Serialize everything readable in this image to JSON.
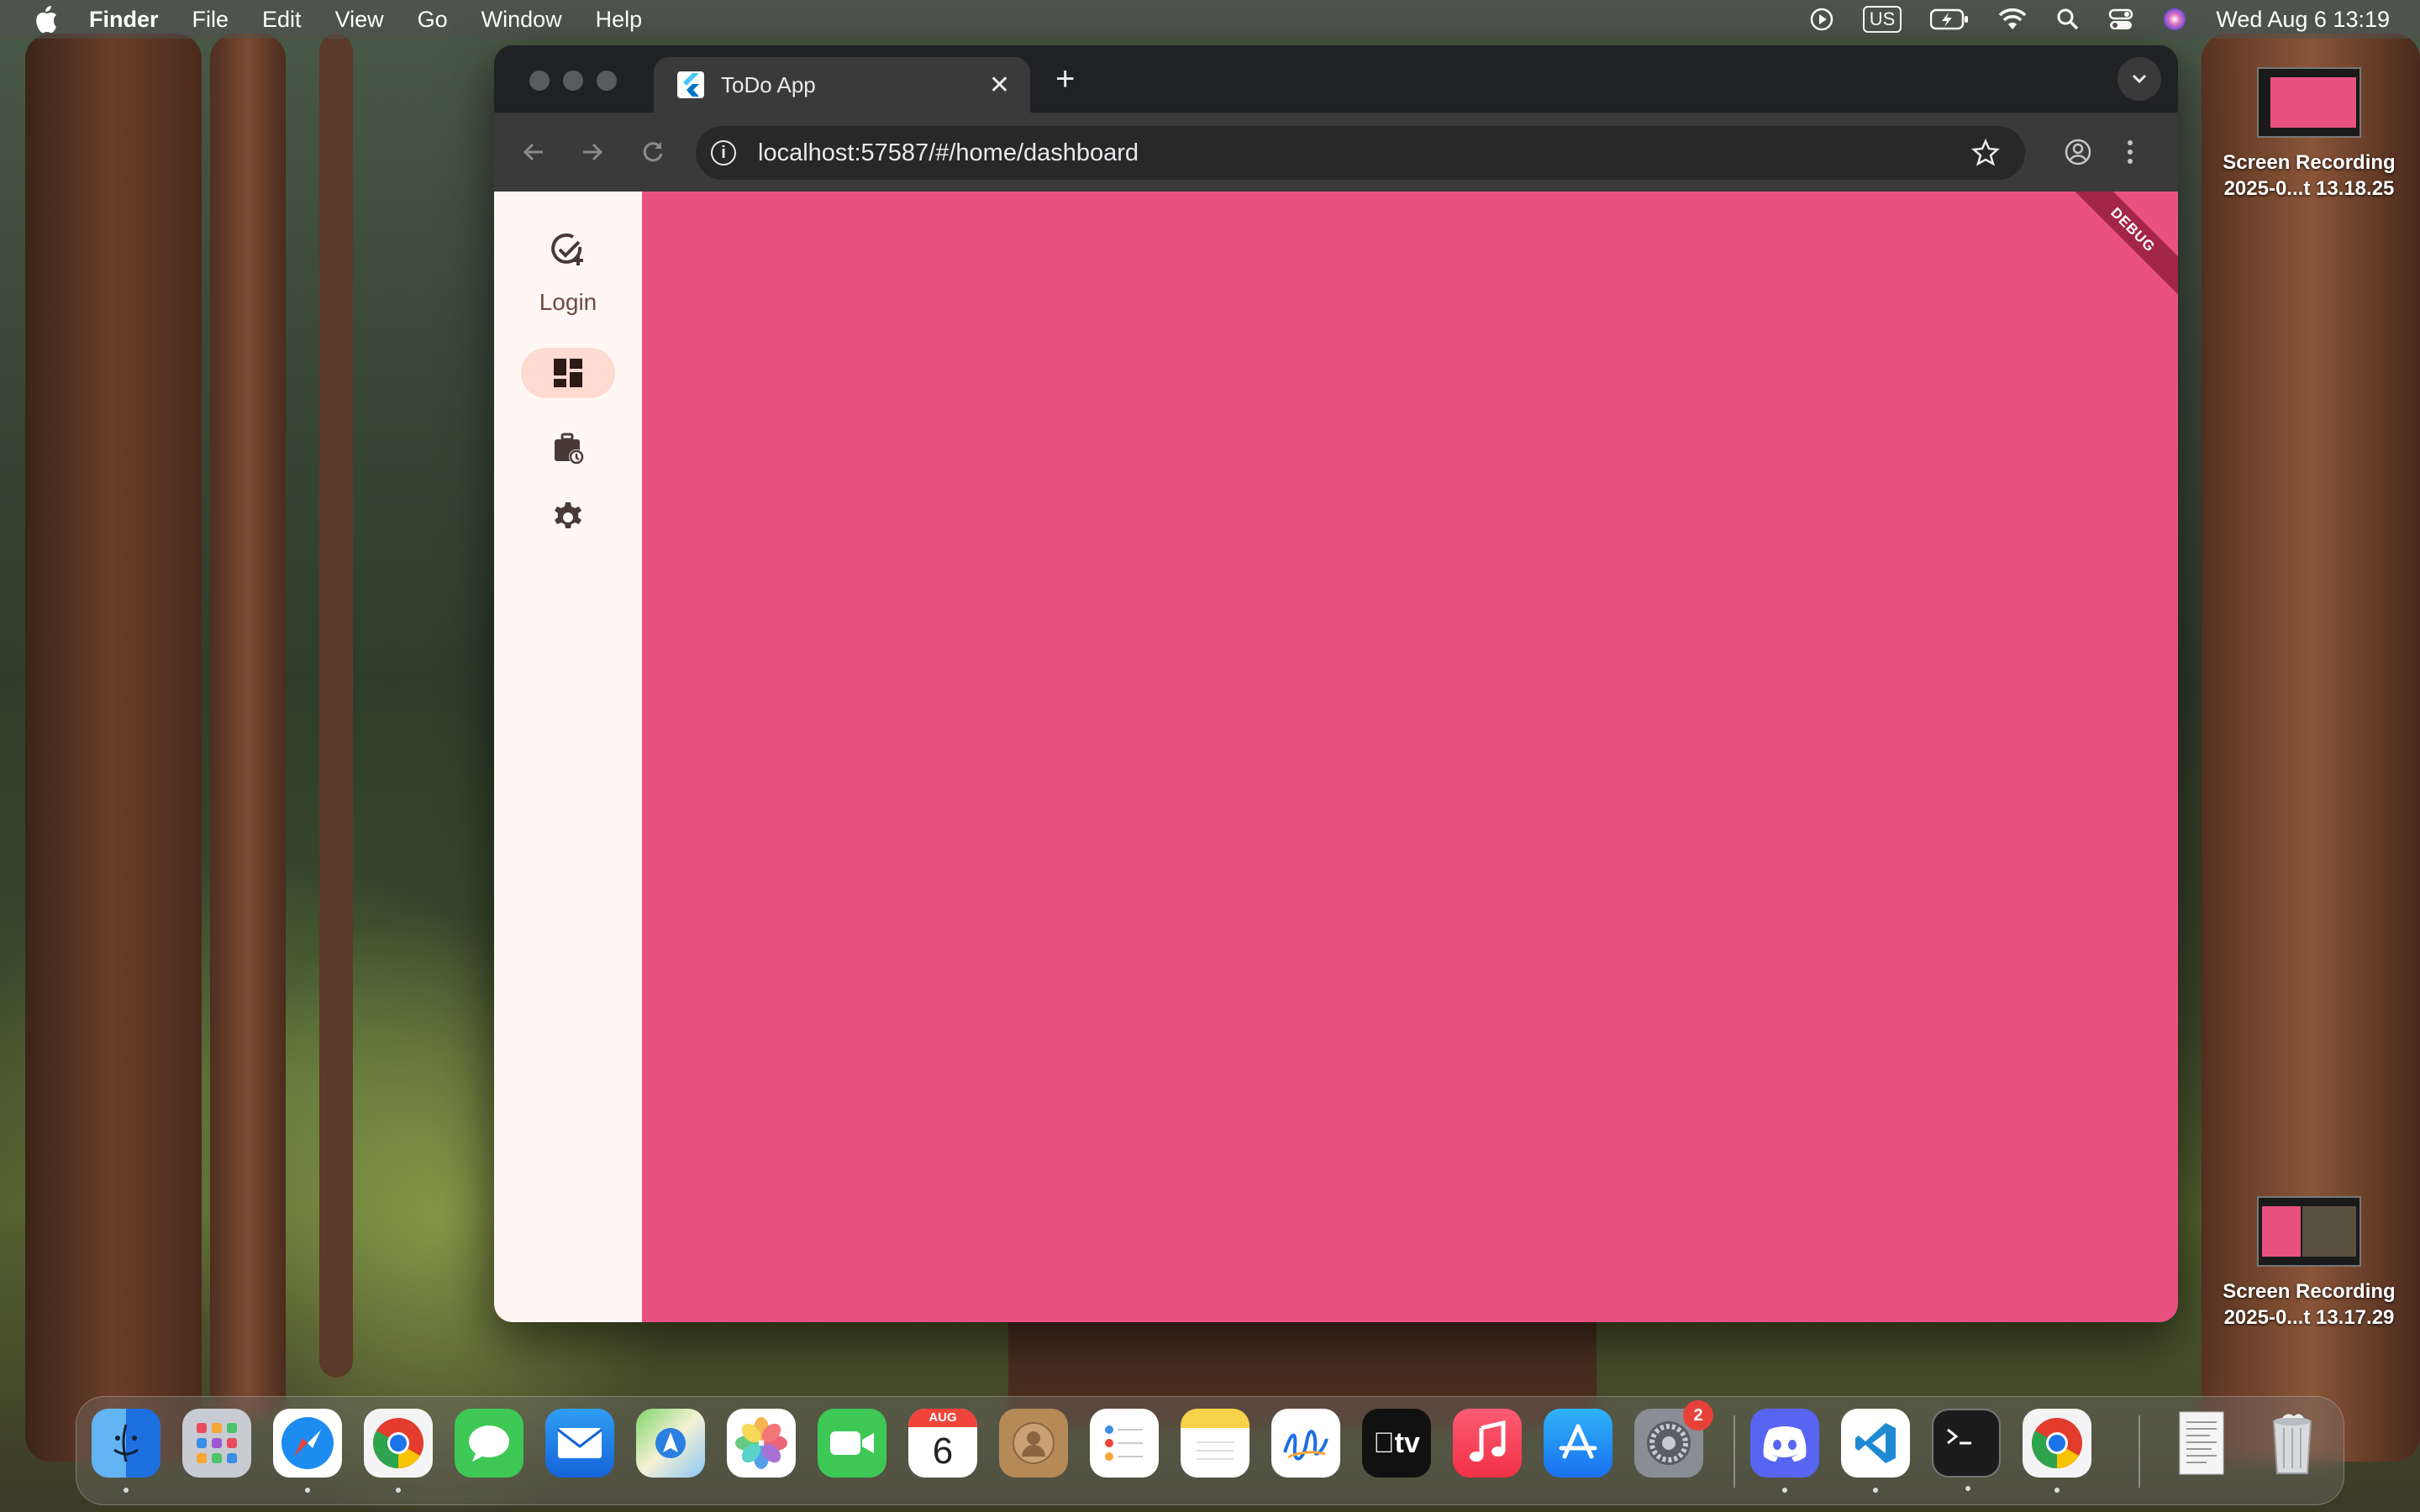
{
  "menubar": {
    "app_name": "Finder",
    "items": [
      "File",
      "Edit",
      "View",
      "Go",
      "Window",
      "Help"
    ],
    "input_source": "US",
    "clock": "Wed Aug 6  13:19"
  },
  "browser": {
    "tab_title": "ToDo App",
    "url": "localhost:57587/#/home/dashboard"
  },
  "app": {
    "rail_fab_label": "Login",
    "debug_banner": "DEBUG",
    "content_color": "#e95280",
    "active_destination": "dashboard"
  },
  "desktop_icons": [
    {
      "line1": "Screen Recording",
      "line2": "2025-0...t 13.18.25"
    },
    {
      "line1": "Screen Recording",
      "line2": "2025-0...t 13.17.29"
    }
  ],
  "dock": {
    "apps": [
      "Finder",
      "Launchpad",
      "Safari",
      "Chrome",
      "Messages",
      "Mail",
      "Maps",
      "Photos",
      "FaceTime",
      "Calendar",
      "Contacts",
      "Reminders",
      "Notes",
      "Freeform",
      "TV",
      "Music",
      "App Store",
      "System Settings",
      "Discord",
      "VS Code",
      "Terminal",
      "Chrome",
      "Documents",
      "Trash"
    ],
    "calendar_month": "AUG",
    "calendar_day": "6",
    "settings_badge": "2",
    "tv_label": "tv"
  }
}
